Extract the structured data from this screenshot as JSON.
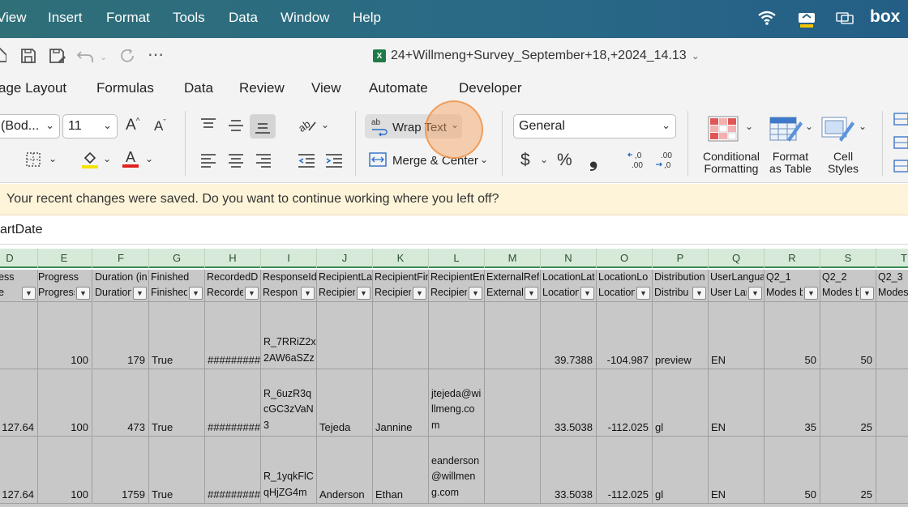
{
  "menubar": {
    "items": [
      "View",
      "Insert",
      "Format",
      "Tools",
      "Data",
      "Window",
      "Help"
    ],
    "status_icons": [
      "wifi-icon",
      "drive-sync-icon",
      "display-icon"
    ],
    "box_label": "box"
  },
  "titlebar": {
    "quick_access": [
      "home-icon",
      "save-icon",
      "save-as-icon",
      "undo-icon",
      "redo-icon",
      "more-icon"
    ],
    "document_title": "24+Willmeng+Survey_September+18,+2024_14.13"
  },
  "ribbon_tabs": [
    "age Layout",
    "Formulas",
    "Data",
    "Review",
    "View",
    "Automate",
    "Developer"
  ],
  "ribbon": {
    "font_name": "(Bod...",
    "font_size": "11",
    "wrap_text": "Wrap Text",
    "merge_center": "Merge & Center",
    "number_format": "General",
    "currency_symbol": "$",
    "percent_symbol": "%",
    "comma_symbol": "❟",
    "conditional_formatting": [
      "Conditional",
      "Formatting"
    ],
    "format_as_table": [
      "Format",
      "as Table"
    ],
    "cell_styles": [
      "Cell",
      "Styles"
    ],
    "accent_colors": {
      "highlight": "#f5e300",
      "font_color": "#e02020"
    }
  },
  "notification": "Your recent changes were saved. Do you want to continue working where you left off?",
  "formula_bar": "artDate",
  "columns": [
    "D",
    "E",
    "F",
    "G",
    "H",
    "I",
    "J",
    "K",
    "L",
    "M",
    "N",
    "O",
    "P",
    "Q",
    "R",
    "S",
    "T"
  ],
  "header_row": [
    [
      "ddress",
      "ddre"
    ],
    [
      "Progress",
      "Progress"
    ],
    [
      "Duration (in",
      "Duration"
    ],
    [
      "Finished",
      "Finished"
    ],
    [
      "RecordedD",
      "Recorde"
    ],
    [
      "ResponseId",
      "Respon"
    ],
    [
      "RecipientLa",
      "Recipien"
    ],
    [
      "RecipientFir",
      "Recipien"
    ],
    [
      "RecipientEm",
      "Recipien"
    ],
    [
      "ExternalRef",
      "External"
    ],
    [
      "LocationLat",
      "Location"
    ],
    [
      "LocationLo",
      "Location"
    ],
    [
      "Distribution",
      "Distribu"
    ],
    [
      "UserLangua",
      "User Lan"
    ],
    [
      "Q2_1",
      "Modes b"
    ],
    [
      "Q2_2",
      "Modes b"
    ],
    [
      "Q2_3",
      "Modes"
    ]
  ],
  "rows": [
    {
      "D": "",
      "E": "100",
      "F": "179",
      "G": "True",
      "H": "#########",
      "I": [
        "R_7RRiZ2x",
        "2AW6aSZz"
      ],
      "J": "",
      "K": "",
      "L": [],
      "M": "",
      "N": "39.7388",
      "O": "-104.987",
      "P": "preview",
      "Q": "EN",
      "R": "50",
      "S": "50",
      "T": ""
    },
    {
      "D": "127.64",
      "E": "100",
      "F": "473",
      "G": "True",
      "H": "#########",
      "I": [
        "R_6uzR3q",
        "cGC3zVaN",
        "3"
      ],
      "J": "Tejeda",
      "K": "Jannine",
      "L": [
        "jtejeda@wi",
        "llmeng.co",
        "m"
      ],
      "M": "",
      "N": "33.5038",
      "O": "-112.025",
      "P": "gl",
      "Q": "EN",
      "R": "35",
      "S": "25",
      "T": ""
    },
    {
      "D": "127.64",
      "E": "100",
      "F": "1759",
      "G": "True",
      "H": "#########",
      "I": [
        "R_1yqkFlC",
        "qHjZG4m"
      ],
      "J": "Anderson",
      "K": "Ethan",
      "L": [
        "eanderson",
        "@willmen",
        "g.com"
      ],
      "M": "",
      "N": "33.5038",
      "O": "-112.025",
      "P": "gl",
      "Q": "EN",
      "R": "50",
      "S": "25",
      "T": ""
    }
  ]
}
